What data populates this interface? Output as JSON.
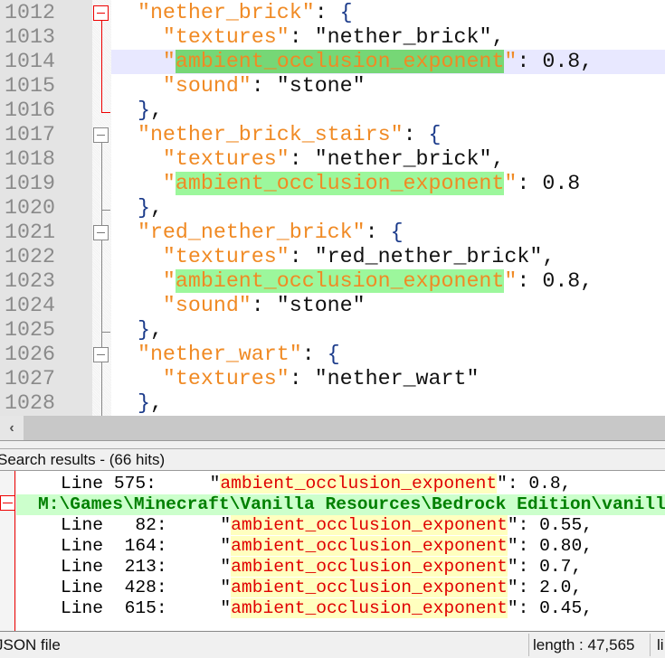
{
  "editor": {
    "lines": [
      {
        "num": "1012",
        "tokens": [
          [
            "p",
            "  "
          ],
          [
            "k",
            "\"nether_brick\""
          ],
          [
            "p",
            ": "
          ],
          [
            "b",
            "{"
          ]
        ]
      },
      {
        "num": "1013",
        "tokens": [
          [
            "p",
            "    "
          ],
          [
            "k",
            "\"textures\""
          ],
          [
            "p",
            ": "
          ],
          [
            "s",
            "\"nether_brick\""
          ],
          [
            "p",
            ","
          ]
        ]
      },
      {
        "num": "1014",
        "current": true,
        "tokens": [
          [
            "p",
            "    "
          ],
          [
            "k",
            "\""
          ],
          [
            "khc",
            "ambient_occlusion_exponent"
          ],
          [
            "k",
            "\""
          ],
          [
            "p",
            ": 0.8,"
          ]
        ]
      },
      {
        "num": "1015",
        "tokens": [
          [
            "p",
            "    "
          ],
          [
            "k",
            "\"sound\""
          ],
          [
            "p",
            ": "
          ],
          [
            "s",
            "\"stone\""
          ]
        ]
      },
      {
        "num": "1016",
        "tokens": [
          [
            "p",
            "  "
          ],
          [
            "b",
            "}"
          ],
          [
            "p",
            ","
          ]
        ]
      },
      {
        "num": "1017",
        "tokens": [
          [
            "p",
            "  "
          ],
          [
            "k",
            "\"nether_brick_stairs\""
          ],
          [
            "p",
            ": "
          ],
          [
            "b",
            "{"
          ]
        ]
      },
      {
        "num": "1018",
        "tokens": [
          [
            "p",
            "    "
          ],
          [
            "k",
            "\"textures\""
          ],
          [
            "p",
            ": "
          ],
          [
            "s",
            "\"nether_brick\""
          ],
          [
            "p",
            ","
          ]
        ]
      },
      {
        "num": "1019",
        "tokens": [
          [
            "p",
            "    "
          ],
          [
            "k",
            "\""
          ],
          [
            "kh",
            "ambient_occlusion_exponent"
          ],
          [
            "k",
            "\""
          ],
          [
            "p",
            ": 0.8"
          ]
        ]
      },
      {
        "num": "1020",
        "tokens": [
          [
            "p",
            "  "
          ],
          [
            "b",
            "}"
          ],
          [
            "p",
            ","
          ]
        ]
      },
      {
        "num": "1021",
        "tokens": [
          [
            "p",
            "  "
          ],
          [
            "k",
            "\"red_nether_brick\""
          ],
          [
            "p",
            ": "
          ],
          [
            "b",
            "{"
          ]
        ]
      },
      {
        "num": "1022",
        "tokens": [
          [
            "p",
            "    "
          ],
          [
            "k",
            "\"textures\""
          ],
          [
            "p",
            ": "
          ],
          [
            "s",
            "\"red_nether_brick\""
          ],
          [
            "p",
            ","
          ]
        ]
      },
      {
        "num": "1023",
        "tokens": [
          [
            "p",
            "    "
          ],
          [
            "k",
            "\""
          ],
          [
            "kh",
            "ambient_occlusion_exponent"
          ],
          [
            "k",
            "\""
          ],
          [
            "p",
            ": 0.8,"
          ]
        ]
      },
      {
        "num": "1024",
        "tokens": [
          [
            "p",
            "    "
          ],
          [
            "k",
            "\"sound\""
          ],
          [
            "p",
            ": "
          ],
          [
            "s",
            "\"stone\""
          ]
        ]
      },
      {
        "num": "1025",
        "tokens": [
          [
            "p",
            "  "
          ],
          [
            "b",
            "}"
          ],
          [
            "p",
            ","
          ]
        ]
      },
      {
        "num": "1026",
        "tokens": [
          [
            "p",
            "  "
          ],
          [
            "k",
            "\"nether_wart\""
          ],
          [
            "p",
            ": "
          ],
          [
            "b",
            "{"
          ]
        ]
      },
      {
        "num": "1027",
        "tokens": [
          [
            "p",
            "    "
          ],
          [
            "k",
            "\"textures\""
          ],
          [
            "p",
            ": "
          ],
          [
            "s",
            "\"nether_wart\""
          ]
        ]
      },
      {
        "num": "1028",
        "tokens": [
          [
            "p",
            "  "
          ],
          [
            "b",
            "}"
          ],
          [
            "p",
            ","
          ]
        ]
      }
    ]
  },
  "scroll_left_icon": "‹",
  "search": {
    "title": "Search results - (66 hits)",
    "rows": [
      {
        "type": "hit",
        "prefix": "    Line 575:     \"",
        "match": "ambient_occlusion_exponent",
        "suffix": "\": 0.8,"
      },
      {
        "type": "file",
        "text": "M:\\Games\\Minecraft\\Vanilla Resources\\Bedrock Edition\\vanilla"
      },
      {
        "type": "hit",
        "prefix": "    Line   82:     \"",
        "match": "ambient_occlusion_exponent",
        "suffix": "\": 0.55,"
      },
      {
        "type": "hit",
        "prefix": "    Line  164:     \"",
        "match": "ambient_occlusion_exponent",
        "suffix": "\": 0.80,"
      },
      {
        "type": "hit",
        "prefix": "    Line  213:     \"",
        "match": "ambient_occlusion_exponent",
        "suffix": "\": 0.7,"
      },
      {
        "type": "hit",
        "prefix": "    Line  428:     \"",
        "match": "ambient_occlusion_exponent",
        "suffix": "\": 2.0,"
      },
      {
        "type": "hit",
        "prefix": "    Line  615:     \"",
        "match": "ambient_occlusion_exponent",
        "suffix": "\": 0.45,"
      }
    ]
  },
  "status": {
    "filetype": "JSON file",
    "length": "length : 47,565",
    "next": "li"
  }
}
